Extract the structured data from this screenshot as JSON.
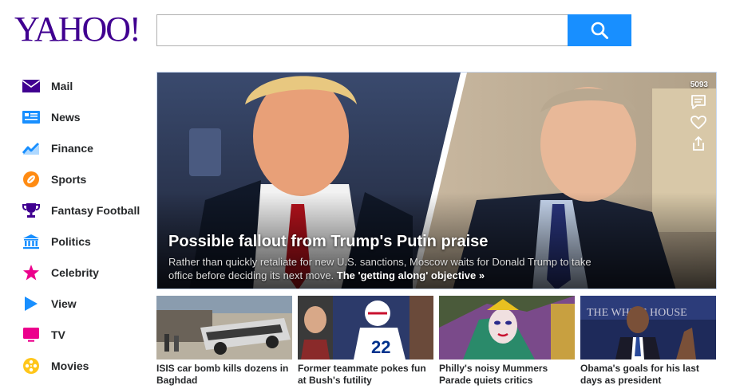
{
  "logo": {
    "text": "YAHOO!"
  },
  "search": {
    "placeholder": "",
    "value": ""
  },
  "sidebar": {
    "items": [
      {
        "label": "Mail",
        "icon": "mail-icon"
      },
      {
        "label": "News",
        "icon": "news-icon"
      },
      {
        "label": "Finance",
        "icon": "finance-chart-icon"
      },
      {
        "label": "Sports",
        "icon": "football-icon"
      },
      {
        "label": "Fantasy Football",
        "icon": "trophy-icon"
      },
      {
        "label": "Politics",
        "icon": "capitol-icon"
      },
      {
        "label": "Celebrity",
        "icon": "star-icon"
      },
      {
        "label": "View",
        "icon": "play-icon"
      },
      {
        "label": "TV",
        "icon": "tv-icon"
      },
      {
        "label": "Movies",
        "icon": "film-reel-icon"
      }
    ]
  },
  "hero": {
    "title": "Possible fallout from Trump's Putin praise",
    "summary": "Rather than quickly retaliate for new U.S. sanctions, Moscow waits for Donald Trump to take office before deciding its next move.",
    "link_label": "The 'getting along' objective »",
    "comment_count": "5093"
  },
  "stories": [
    {
      "title": "ISIS car bomb kills dozens in Baghdad"
    },
    {
      "title": "Former teammate pokes fun at Bush's futility"
    },
    {
      "title": "Philly's noisy Mummers Parade quiets critics"
    },
    {
      "title": "Obama's goals for his last days as president"
    }
  ],
  "colors": {
    "brand": "#400090",
    "search_button": "#188fff",
    "nav_mail": "#400090",
    "nav_news": "#188fff",
    "nav_finance": "#188fff",
    "nav_sports": "#ff8b12",
    "nav_fantasy": "#400090",
    "nav_politics": "#188fff",
    "nav_celebrity": "#ec008c",
    "nav_view": "#188fff",
    "nav_tv": "#ec008c",
    "nav_movies": "#ffc61a"
  }
}
